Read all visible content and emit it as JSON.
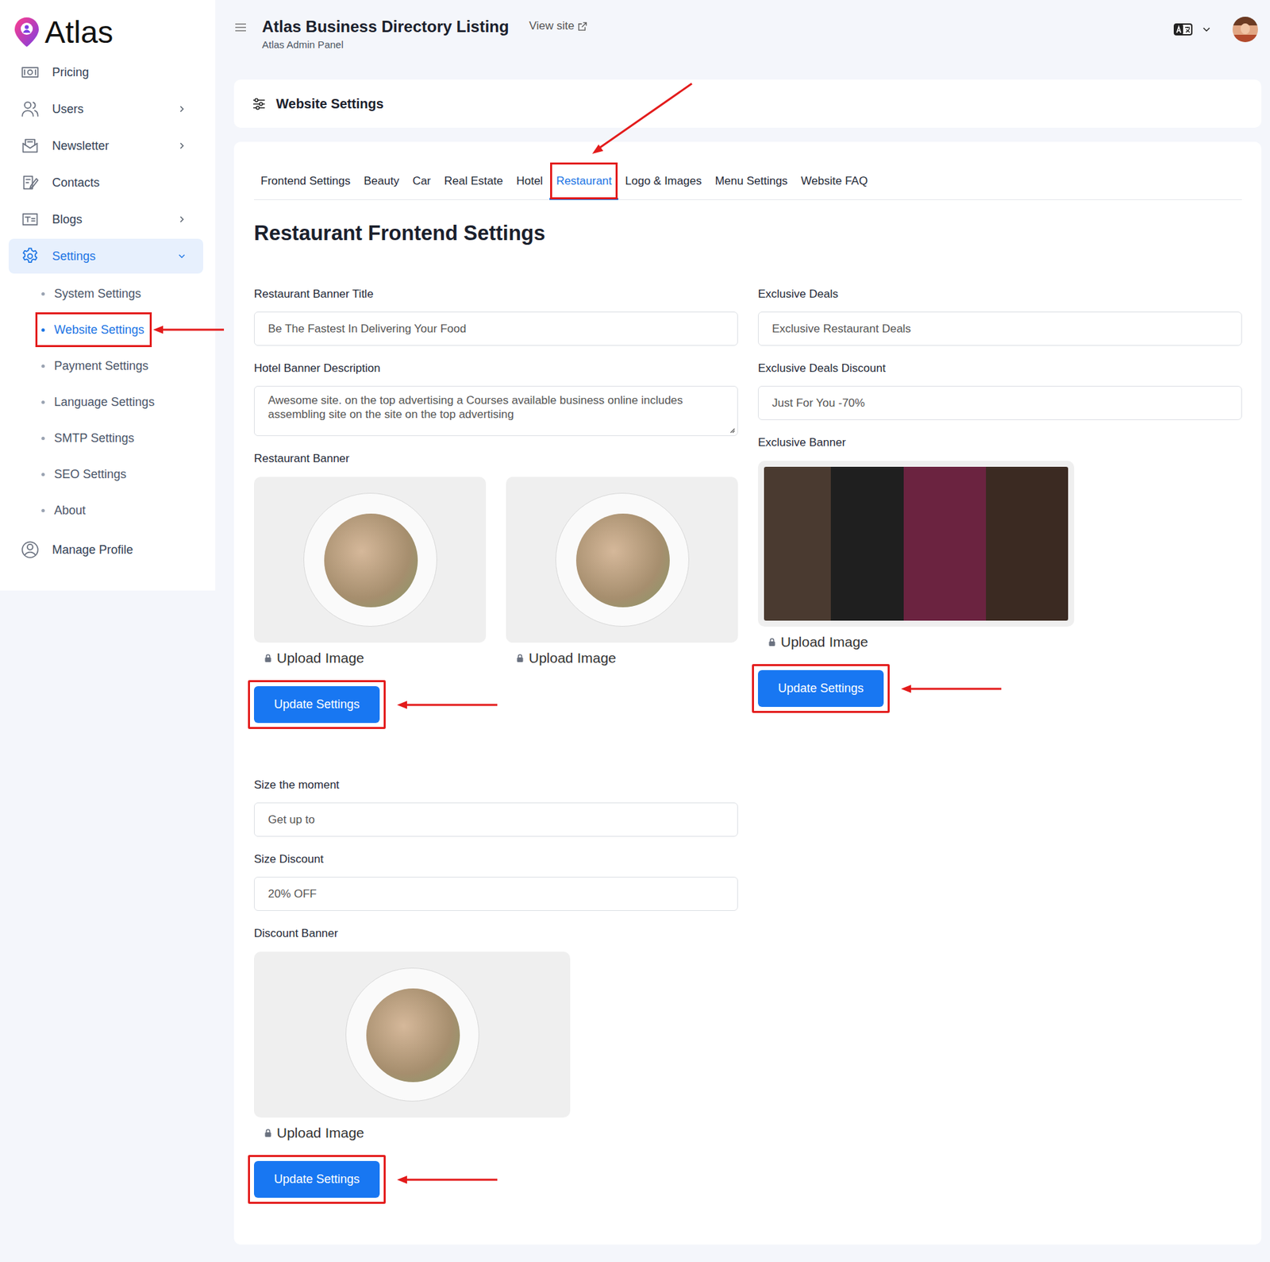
{
  "brand": {
    "name": "Atlas"
  },
  "header": {
    "title": "Atlas Business Directory Listing",
    "subtitle": "Atlas Admin Panel",
    "view_site": "View site"
  },
  "sidebar": {
    "items": [
      {
        "label": "Pricing",
        "expandable": false,
        "expanded": false,
        "selected": false,
        "children": []
      },
      {
        "label": "Users",
        "expandable": true,
        "expanded": false,
        "selected": false,
        "children": []
      },
      {
        "label": "Newsletter",
        "expandable": true,
        "expanded": false,
        "selected": false,
        "children": []
      },
      {
        "label": "Contacts",
        "expandable": false,
        "expanded": false,
        "selected": false,
        "children": []
      },
      {
        "label": "Blogs",
        "expandable": true,
        "expanded": false,
        "selected": false,
        "children": []
      },
      {
        "label": "Settings",
        "expandable": true,
        "expanded": true,
        "selected": true,
        "children": [
          {
            "label": "System Settings",
            "selected": false,
            "annotated": false
          },
          {
            "label": "Website Settings",
            "selected": true,
            "annotated": true
          },
          {
            "label": "Payment Settings",
            "selected": false,
            "annotated": false
          },
          {
            "label": "Language Settings",
            "selected": false,
            "annotated": false
          },
          {
            "label": "SMTP Settings",
            "selected": false,
            "annotated": false
          },
          {
            "label": "SEO Settings",
            "selected": false,
            "annotated": false
          },
          {
            "label": "About",
            "selected": false,
            "annotated": false
          }
        ]
      },
      {
        "label": "Manage Profile",
        "expandable": false,
        "expanded": false,
        "selected": false,
        "children": []
      }
    ]
  },
  "page_card": {
    "title": "Website Settings"
  },
  "tabs": [
    {
      "label": "Frontend Settings",
      "selected": false,
      "annotated": false
    },
    {
      "label": "Beauty",
      "selected": false,
      "annotated": false
    },
    {
      "label": "Car",
      "selected": false,
      "annotated": false
    },
    {
      "label": "Real Estate",
      "selected": false,
      "annotated": false
    },
    {
      "label": "Hotel",
      "selected": false,
      "annotated": false
    },
    {
      "label": "Restaurant",
      "selected": true,
      "annotated": true
    },
    {
      "label": "Logo & Images",
      "selected": false,
      "annotated": false
    },
    {
      "label": "Menu Settings",
      "selected": false,
      "annotated": false
    },
    {
      "label": "Website FAQ",
      "selected": false,
      "annotated": false
    }
  ],
  "form": {
    "heading": "Restaurant Frontend Settings",
    "columns": [
      {
        "sections": [
          {
            "fields": [
              {
                "label": "Restaurant Banner Title",
                "value": "Be The Fastest In Delivering Your Food",
                "kind": "input"
              },
              {
                "label": "Hotel Banner Description",
                "value": "Awesome site. on the top advertising a Courses available business online includes assembling site on the site on the top advertising",
                "kind": "textarea"
              }
            ],
            "banner": {
              "label": "Restaurant Banner",
              "images": [
                {
                  "kind": "cutout",
                  "upload_label": "Upload Image"
                },
                {
                  "kind": "cutout",
                  "upload_label": "Upload Image"
                }
              ]
            },
            "button": {
              "label": "Update Settings",
              "annotated": true
            }
          },
          {
            "fields": [
              {
                "label": "Size the moment",
                "value": "Get up to",
                "kind": "input"
              },
              {
                "label": "Size Discount",
                "value": "20% OFF",
                "kind": "input"
              }
            ],
            "banner": {
              "label": "Discount Banner",
              "images": [
                {
                  "kind": "cutout",
                  "upload_label": "Upload Image"
                }
              ]
            },
            "button": {
              "label": "Update Settings",
              "annotated": true
            }
          }
        ]
      },
      {
        "sections": [
          {
            "fields": [
              {
                "label": "Exclusive Deals",
                "value": "Exclusive Restaurant Deals",
                "kind": "input"
              },
              {
                "label": "Exclusive Deals Discount",
                "value": "Just For You -70%",
                "kind": "input"
              }
            ],
            "banner": {
              "label": "Exclusive Banner",
              "images": [
                {
                  "kind": "collage",
                  "upload_label": "Upload Image"
                }
              ]
            },
            "button": {
              "label": "Update Settings",
              "annotated": true
            }
          }
        ]
      }
    ]
  }
}
